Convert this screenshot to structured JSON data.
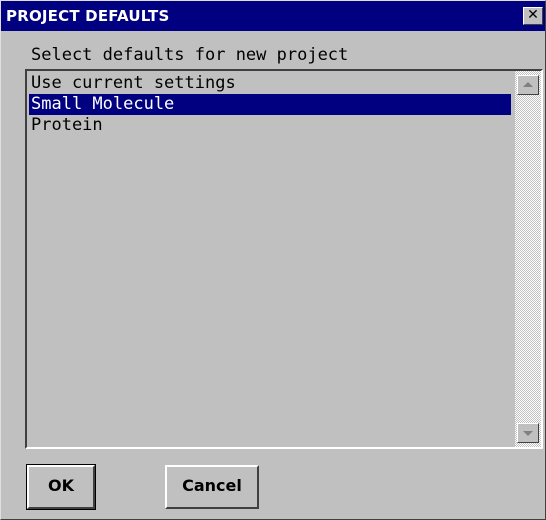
{
  "window": {
    "title": "PROJECT DEFAULTS",
    "close_glyph": "✕"
  },
  "prompt": "Select defaults for new project",
  "list": {
    "items": [
      {
        "label": "Use current settings",
        "selected": false
      },
      {
        "label": "Small Molecule",
        "selected": true
      },
      {
        "label": "Protein",
        "selected": false
      }
    ]
  },
  "buttons": {
    "ok_label": "OK",
    "cancel_label": "Cancel"
  },
  "colors": {
    "titlebar": "#000080",
    "face": "#c0c0c0",
    "selection": "#000080"
  },
  "icons": {
    "close": "close-icon",
    "scroll_up": "arrow-up-icon",
    "scroll_down": "arrow-down-icon"
  }
}
